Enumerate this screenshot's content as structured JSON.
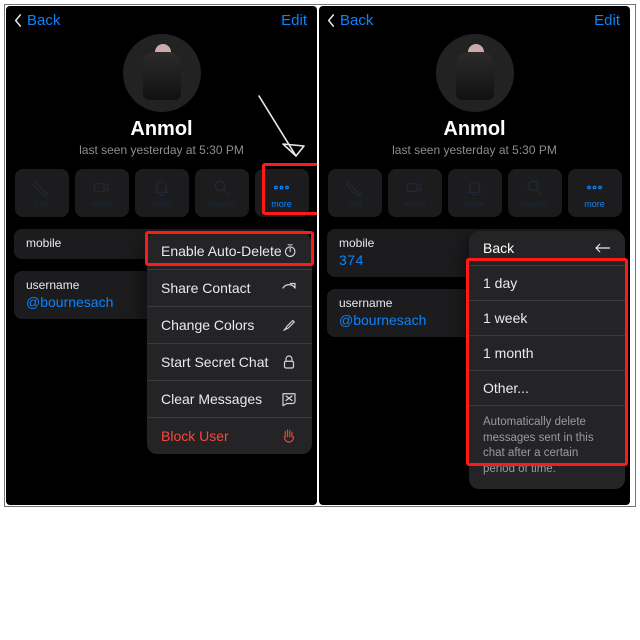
{
  "nav": {
    "back": "Back",
    "edit": "Edit"
  },
  "profile": {
    "name": "Anmol",
    "lastseen": "last seen yesterday at 5:30 PM"
  },
  "actions": {
    "call": "call",
    "video": "video",
    "mute": "mute",
    "search": "search",
    "more": "more"
  },
  "info": {
    "mobile_label": "mobile",
    "mobile_partial": "",
    "username_label": "username",
    "username": "@bournesach"
  },
  "menu": {
    "enable_auto_delete": "Enable Auto-Delete",
    "share_contact": "Share Contact",
    "change_colors": "Change Colors",
    "start_secret_chat": "Start Secret Chat",
    "clear_messages": "Clear Messages",
    "block_user": "Block User"
  },
  "submenu": {
    "back": "Back",
    "opt_day": "1 day",
    "opt_week": "1 week",
    "opt_month": "1 month",
    "opt_other": "Other...",
    "note": "Automatically delete messages sent in this chat after a certain period of time."
  }
}
